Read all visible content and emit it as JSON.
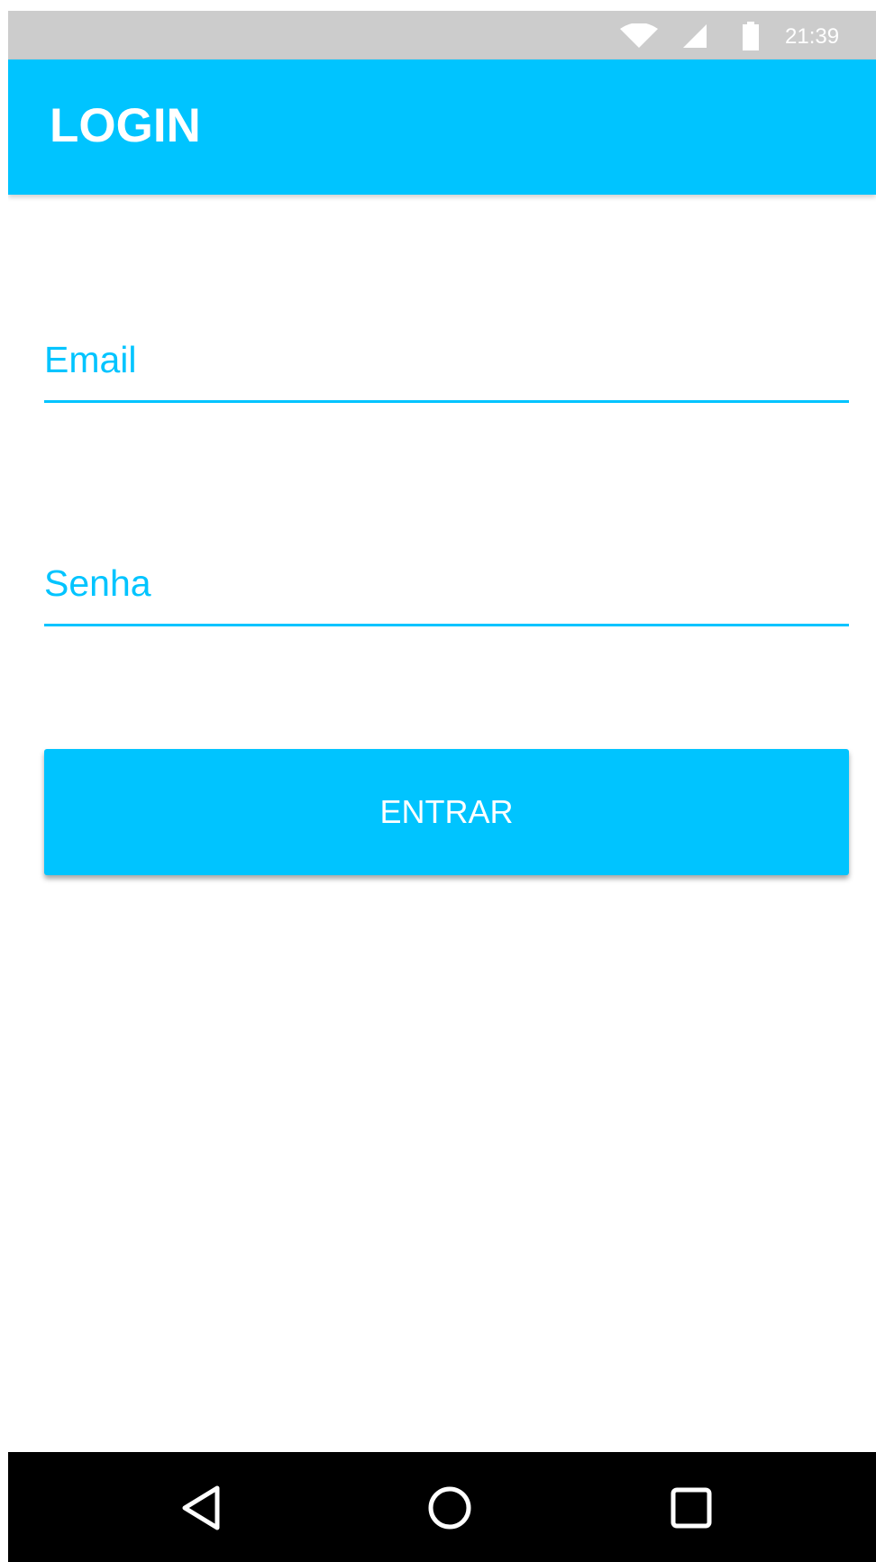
{
  "status_bar": {
    "time": "21:39",
    "icons": [
      "wifi-icon",
      "signal-icon",
      "battery-icon"
    ]
  },
  "app_bar": {
    "title": "LOGIN"
  },
  "form": {
    "email_placeholder": "Email",
    "password_placeholder": "Senha",
    "submit_label": "ENTRAR"
  },
  "nav_bar": {
    "icons": [
      "back-icon",
      "home-icon",
      "recent-apps-icon"
    ]
  },
  "colors": {
    "accent": "#00c4ff",
    "status_bar": "#cccccc",
    "nav_bar": "#000000",
    "background": "#ffffff"
  }
}
